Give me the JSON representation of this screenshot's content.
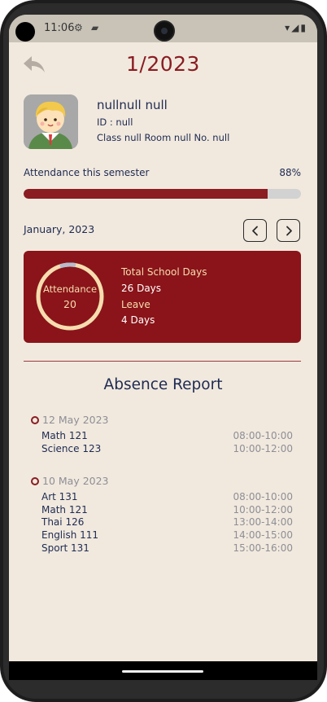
{
  "status_bar": {
    "time": "11:06",
    "icons": [
      "settings-icon",
      "sim-card-icon",
      "wifi-icon",
      "signal-icon",
      "battery-icon"
    ]
  },
  "header": {
    "title": "1/2023",
    "back_icon": "back-arrow-icon"
  },
  "student": {
    "name": "nullnull null",
    "id_line": "ID : null",
    "class_line": "Class null Room null No. null"
  },
  "attendance": {
    "label": "Attendance this semester",
    "percent_text": "88%",
    "progress": 0.88
  },
  "month": {
    "label": "January, 2023",
    "prev_icon": "chevron-left-icon",
    "next_icon": "chevron-right-icon"
  },
  "summary_card": {
    "ring_label": "Attendance",
    "ring_value": "20",
    "total_label": "Total School Days",
    "total_value": "26 Days",
    "leave_label": "Leave",
    "leave_value": "4 Days"
  },
  "absence": {
    "title": "Absence Report",
    "groups": [
      {
        "date": "12 May 2023",
        "items": [
          {
            "subject": "Math 121",
            "time": "08:00-10:00"
          },
          {
            "subject": "Science 123",
            "time": "10:00-12:00"
          }
        ]
      },
      {
        "date": "10 May 2023",
        "items": [
          {
            "subject": "Art 131",
            "time": "08:00-10:00"
          },
          {
            "subject": "Math 121",
            "time": "10:00-12:00"
          },
          {
            "subject": "Thai 126",
            "time": "13:00-14:00"
          },
          {
            "subject": "English 111",
            "time": "14:00-15:00"
          },
          {
            "subject": "Sport 131",
            "time": "15:00-16:00"
          }
        ]
      }
    ]
  },
  "colors": {
    "accent": "#8a1c22",
    "background": "#f1e9de",
    "text": "#1e2a52"
  }
}
